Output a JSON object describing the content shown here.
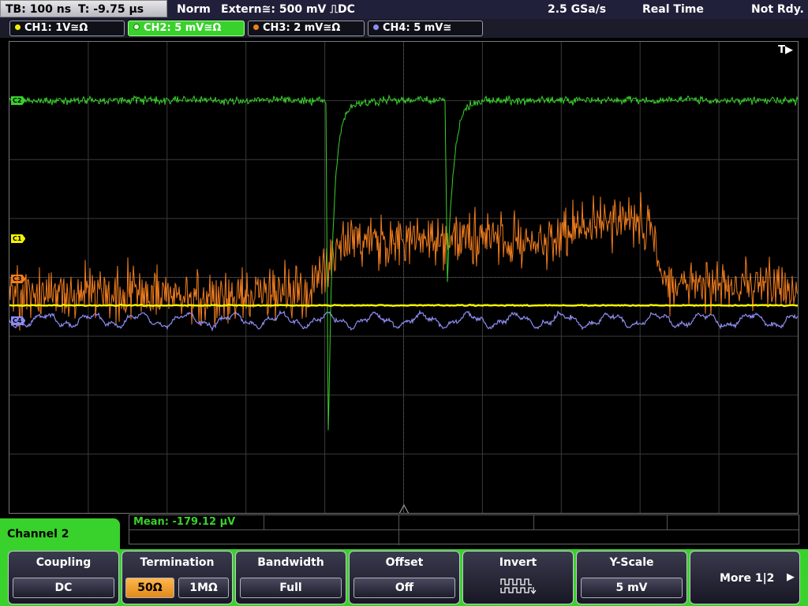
{
  "status": {
    "timebase": "TB: 100 ns",
    "time_offset": "T: -9.75 µs",
    "acq_mode": "Norm",
    "trigger": "Extern≅: 500 mV ⎍DC",
    "sample_rate": "2.5 GSa/s",
    "acq_type": "Real Time",
    "trigger_state": "Not Rdy."
  },
  "channels": [
    {
      "label": "CH1: 1V≅Ω",
      "color": "#f2f200"
    },
    {
      "label": "CH2: 5 mV≅Ω",
      "color": "#39d12b"
    },
    {
      "label": "CH3: 2 mV≅Ω",
      "color": "#f07d1e"
    },
    {
      "label": "CH4: 5 mV≅",
      "color": "#8c8cf0"
    }
  ],
  "markers": {
    "c1": "C1",
    "c2": "C2",
    "c3": "C3",
    "c4": "C4"
  },
  "trigger_marker": "T▶",
  "measurement": {
    "label": "Mean: -179.12 µV"
  },
  "menu": {
    "title": "Channel 2"
  },
  "softkeys": {
    "coupling": {
      "label": "Coupling",
      "value": "DC"
    },
    "termination": {
      "label": "Termination",
      "value_a": "50Ω",
      "value_b": "1MΩ"
    },
    "bandwidth": {
      "label": "Bandwidth",
      "value": "Full"
    },
    "offset": {
      "label": "Offset",
      "value": "Off"
    },
    "invert": {
      "label": "Invert"
    },
    "yscale": {
      "label": "Y-Scale",
      "value": "5 mV"
    },
    "more": {
      "label": "More 1|2"
    }
  },
  "colors": {
    "ch1": "#f2f200",
    "ch2": "#39d12b",
    "ch3": "#f07d1e",
    "ch4": "#8c8cf0",
    "menu_bg": "#39d12b",
    "selected": "#f5a53a"
  }
}
